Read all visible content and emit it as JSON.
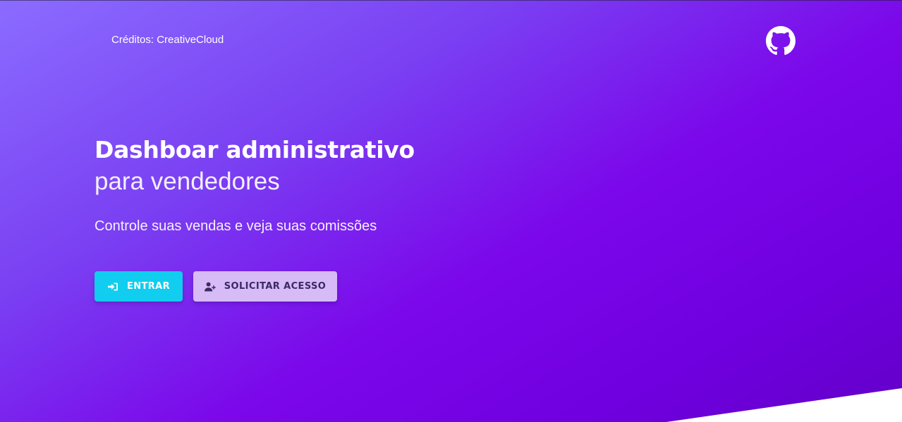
{
  "header": {
    "credits": "Créditos: CreativeCloud",
    "github_icon": "github-icon"
  },
  "hero": {
    "title_strong": "Dashboar administrativo",
    "title_light": "para vendedores",
    "lead": "Controle suas vendas e veja suas comissões"
  },
  "actions": {
    "login_label": "ENTRAR",
    "login_icon": "sign-in-icon",
    "request_label": "SOLICITAR ACESSO",
    "request_icon": "user-plus-icon"
  },
  "colors": {
    "gradient_start": "#8b6cff",
    "gradient_end": "#6200c8",
    "login_button": "#11cdef",
    "request_button": "#d6bbf7",
    "request_text": "#3b2a62"
  }
}
